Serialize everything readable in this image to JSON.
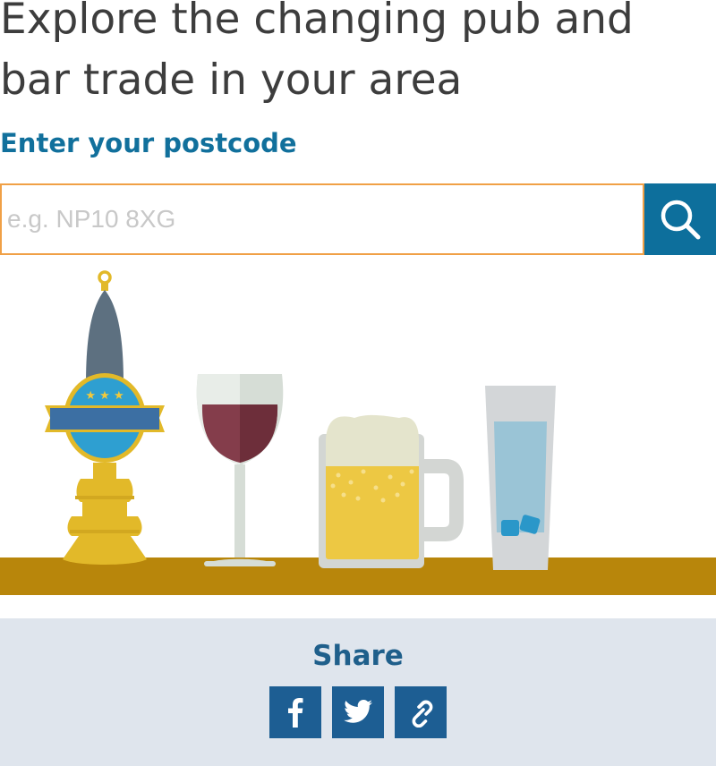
{
  "headline": "Explore the changing pub and bar trade in your area",
  "postcode": {
    "label": "Enter your postcode",
    "placeholder": "e.g. NP10 8XG",
    "value": "",
    "search_icon": "search-icon"
  },
  "illustration": {
    "items": [
      "beer-pump-icon",
      "red-wine-glass-icon",
      "beer-mug-icon",
      "water-glass-icon"
    ],
    "colors": {
      "bar": "#b8860b",
      "pump_handle": "#5d7080",
      "pump_gold": "#e2b929",
      "pump_blue": "#2e9fd1",
      "wine": "#843d4b",
      "beer": "#edc843",
      "foam": "#e4e4cc",
      "water": "#9ac4d6",
      "ice": "#2a97c9"
    }
  },
  "share": {
    "title": "Share",
    "buttons": [
      {
        "icon": "facebook-icon"
      },
      {
        "icon": "twitter-icon"
      },
      {
        "icon": "link-icon"
      }
    ]
  },
  "colors": {
    "accent": "#11709c",
    "input_border": "#f0a046",
    "share_bg": "#dfe5ed",
    "share_button": "#1d5e93"
  }
}
